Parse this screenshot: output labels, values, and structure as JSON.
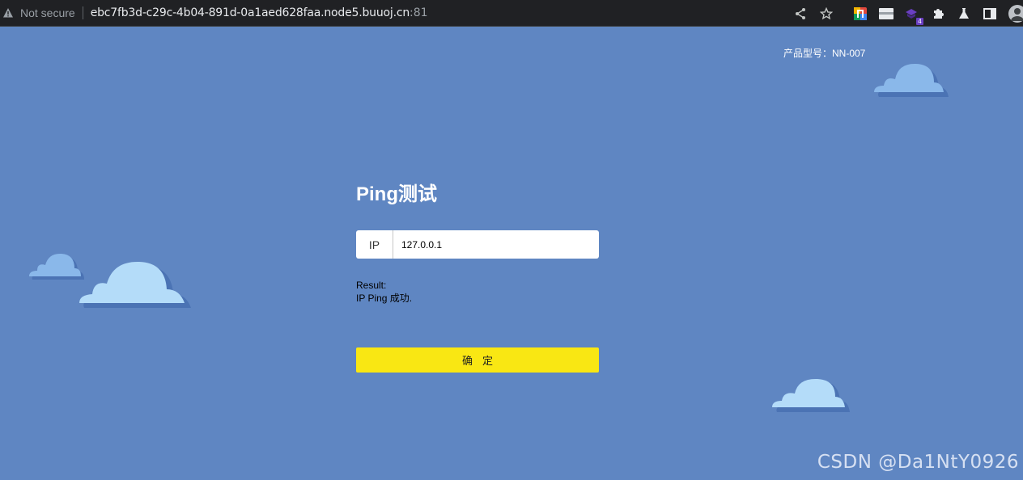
{
  "browser": {
    "security_label": "Not secure",
    "url_host": "ebc7fb3d-c29c-4b04-891d-0a1aed628faa.node5.buuoj.cn",
    "url_port": ":81",
    "extension_badge": "4",
    "icons": [
      "warning-icon",
      "share-icon",
      "star-icon",
      "extension-color-icon",
      "extension-window-icon",
      "extension-purple-icon",
      "puzzle-icon",
      "labs-flask-icon",
      "side-panel-icon",
      "profile-avatar"
    ]
  },
  "page": {
    "model": "产品型号：NN-007",
    "title": "Ping测试",
    "ip_label": "IP",
    "ip_value": "127.0.0.1",
    "result_label": "Result:",
    "result_text": "IP Ping 成功.",
    "confirm_label": "确定"
  },
  "watermark": "CSDN @Da1NtY0926",
  "colors": {
    "background": "#5f86c2",
    "button": "#f9e713",
    "cloud_light": "#b4dcf9",
    "cloud_dark": "#8ab8ea"
  }
}
